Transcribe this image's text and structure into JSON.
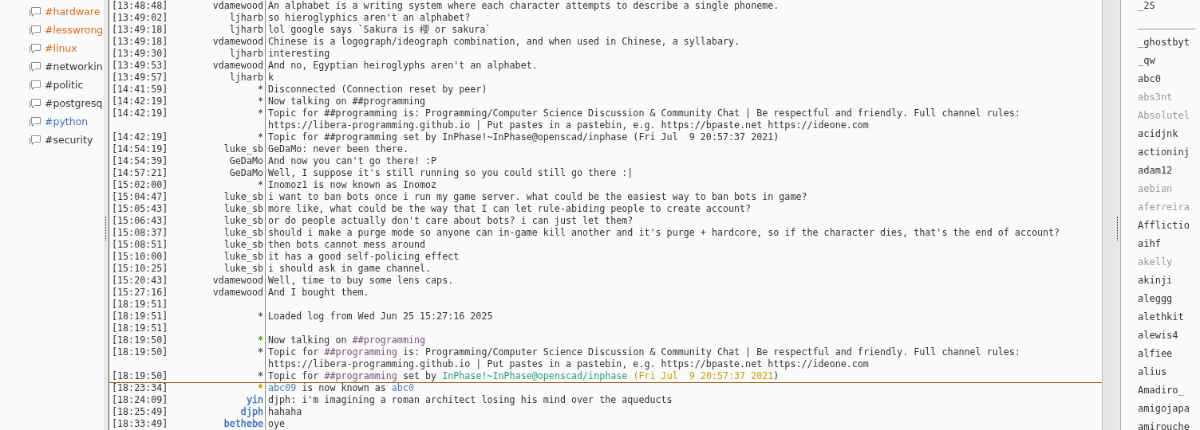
{
  "channels": [
    {
      "name": "#hardware",
      "color": "#d76b1c"
    },
    {
      "name": "#lesswrong",
      "color": "#d76b1c"
    },
    {
      "name": "#linux",
      "color": "#d76b1c"
    },
    {
      "name": "#networkin",
      "color": "#2e3436"
    },
    {
      "name": "#politic",
      "color": "#2e3436"
    },
    {
      "name": "#postgresq",
      "color": "#2e3436"
    },
    {
      "name": "#python",
      "color": "#3a6fbf"
    },
    {
      "name": "#security",
      "color": "#2e3436"
    }
  ],
  "chat": [
    {
      "time": "[13:48:48]",
      "nick": "vdamewood",
      "message": "An alphabet is a writing system where each character attempts to describe a single phoneme.",
      "marker_below": false
    },
    {
      "time": "[13:49:02]",
      "nick": "ljharb",
      "message": "so hieroglyphics aren't an alphabet?",
      "marker_below": false
    },
    {
      "time": "[13:49:18]",
      "nick": "ljharb",
      "message": "lol google says `Sakura is 櫻 or sakura`",
      "marker_below": false
    },
    {
      "time": "[13:49:18]",
      "nick": "vdamewood",
      "message": "Chinese is a logograph/ideograph combination, and when used in Chinese, a syllabary.",
      "marker_below": false
    },
    {
      "time": "[13:49:30]",
      "nick": "ljharb",
      "message": "interesting",
      "marker_below": false
    },
    {
      "time": "[13:49:53]",
      "nick": "vdamewood",
      "message": "And no, Egyptian heiroglyphs aren't an alphabet.",
      "marker_below": false
    },
    {
      "time": "[13:49:57]",
      "nick": "ljharb",
      "message": "k",
      "marker_below": false
    },
    {
      "time": "[14:41:59]",
      "nick": "*",
      "message": "Disconnected (Connection reset by peer)",
      "marker_below": false
    },
    {
      "time": "[14:42:19]",
      "nick": "*",
      "message": "Now talking on ##programming",
      "marker_below": false
    },
    {
      "time": "[14:42:19]",
      "nick": "*",
      "message": "Topic for ##programming is: Programming/Computer Science Discussion & Community Chat | Be respectful and friendly. Full channel rules: https://libera-programming.github.io | Put pastes in a pastebin, e.g. https://bpaste.net https://ideone.com",
      "marker_below": false
    },
    {
      "time": "[14:42:19]",
      "nick": "*",
      "message": "Topic for ##programming set by InPhase!~InPhase@openscad/inphase (Fri Jul  9 20:57:37 2021)",
      "marker_below": false
    },
    {
      "time": "[14:54:19]",
      "nick": "luke_sb",
      "message": "GeDaMo: never been there.",
      "marker_below": false
    },
    {
      "time": "[14:54:39]",
      "nick": "GeDaMo",
      "message": "And now you can't go there! :P",
      "marker_below": false
    },
    {
      "time": "[14:57:21]",
      "nick": "GeDaMo",
      "message": "Well, I suppose it's still running so you could still go there :|",
      "marker_below": false
    },
    {
      "time": "[15:02:00]",
      "nick": "*",
      "message": "Inomoz1 is now known as Inomoz",
      "marker_below": false
    },
    {
      "time": "[15:04:47]",
      "nick": "luke_sb",
      "message": "i want to ban bots once i run my game server. what could be the easiest way to ban bots in game?",
      "marker_below": false
    },
    {
      "time": "[15:05:43]",
      "nick": "luke_sb",
      "message": "more like, what could be the way that I can let rule-abiding people to create account?",
      "marker_below": false
    },
    {
      "time": "[15:06:43]",
      "nick": "luke_sb",
      "message": "or do people actually don't care about bots? i can just let them?",
      "marker_below": false
    },
    {
      "time": "[15:08:37]",
      "nick": "luke_sb",
      "message": "should i make a purge mode so anyone can in-game kill another and it's purge + hardcore, so if the character dies, that's the end of account?",
      "marker_below": false
    },
    {
      "time": "[15:08:51]",
      "nick": "luke_sb",
      "message": "then bots cannot mess around",
      "marker_below": false
    },
    {
      "time": "[15:10:00]",
      "nick": "luke_sb",
      "message": "it has a good self-policing effect",
      "marker_below": false
    },
    {
      "time": "[15:10:25]",
      "nick": "luke_sb",
      "message": "i should ask in game channel.",
      "marker_below": false
    },
    {
      "time": "[15:20:43]",
      "nick": "vdamewood",
      "message": "Well, time to buy some lens caps.",
      "marker_below": false
    },
    {
      "time": "[15:27:16]",
      "nick": "vdamewood",
      "message": "And I bought them.",
      "marker_below": false
    },
    {
      "time": "[18:19:51]",
      "marker_below": false
    },
    {
      "time": "[18:19:51]",
      "nick": "*",
      "message": "Loaded log from Wed Jun 25 15:27:16 2025",
      "marker_below": false
    },
    {
      "time": "[18:19:51]",
      "marker_below": false
    },
    {
      "time": "[18:19:50]",
      "nick": "*",
      "color": "#4e9a06",
      "parts": [
        {
          "text": "Now talking on ",
          "kind": "plain"
        },
        {
          "text": "##programming",
          "kind": "channel"
        }
      ],
      "marker_below": false
    },
    {
      "time": "[18:19:50]",
      "nick": "*",
      "color": "#75507b",
      "parts": [
        {
          "text": "Topic for ",
          "kind": "plain"
        },
        {
          "text": "##programming",
          "kind": "channel"
        },
        {
          "text": " is: Programming/Computer Science Discussion & Community Chat | Be respectful and friendly. Full channel rules: https://libera-programming.github.io | Put pastes in a pastebin, e.g. https://bpaste.net https://ideone.com",
          "kind": "plain"
        }
      ],
      "marker_below": false
    },
    {
      "time": "[18:19:50]",
      "nick": "*",
      "color": "#75507b",
      "parts": [
        {
          "text": "Topic for ",
          "kind": "plain"
        },
        {
          "text": "##programming",
          "kind": "channel"
        },
        {
          "text": " set by ",
          "kind": "plain"
        },
        {
          "text": "InPhase!~InPhase@openscad/inphase",
          "kind": "host"
        },
        {
          "text": " (Fri Jul  9 20:57:37 2021",
          "kind": "date"
        },
        {
          "text": ")",
          "kind": "plain"
        }
      ],
      "marker_below": true
    },
    {
      "time": "[18:23:34]",
      "nick": "*",
      "color": "#c4a000",
      "parts": [
        {
          "text": "abc09",
          "kind": "nick"
        },
        {
          "text": " is now known as ",
          "kind": "plain"
        },
        {
          "text": "abc0",
          "kind": "nick"
        }
      ],
      "marker_below": false
    },
    {
      "time": "[18:24:09]",
      "nick": "yin",
      "color": "#3a6fbf",
      "message": "djph: i'm imagining a roman architect losing his mind over the aqueducts",
      "marker_below": false
    },
    {
      "time": "[18:25:49]",
      "nick": "djph",
      "color": "#3a6fbf",
      "message": "hahaha",
      "marker_below": false
    },
    {
      "time": "[18:33:49]",
      "nick": "bethebe",
      "color": "#3a6fbf",
      "message": "oye",
      "marker_below": false
    }
  ],
  "users": [
    {
      "name": "_2S",
      "away": false
    },
    {
      "name": "__________",
      "away": false
    },
    {
      "name": "_ghostbyt",
      "away": false
    },
    {
      "name": "_qw",
      "away": false
    },
    {
      "name": "abc0",
      "away": false
    },
    {
      "name": "abs3nt",
      "away": true
    },
    {
      "name": "Absolutel",
      "away": true
    },
    {
      "name": "acidjnk",
      "away": false
    },
    {
      "name": "actioninj",
      "away": false
    },
    {
      "name": "adam12",
      "away": false
    },
    {
      "name": "aebian",
      "away": true
    },
    {
      "name": "aferreira",
      "away": true
    },
    {
      "name": "Afflictio",
      "away": false
    },
    {
      "name": "aihf",
      "away": false
    },
    {
      "name": "akelly",
      "away": true
    },
    {
      "name": "akinji",
      "away": false
    },
    {
      "name": "aleggg",
      "away": false
    },
    {
      "name": "alethkit",
      "away": false
    },
    {
      "name": "alewis4",
      "away": false
    },
    {
      "name": "alfiee",
      "away": false
    },
    {
      "name": "alius",
      "away": false
    },
    {
      "name": "Amadiro_",
      "away": false
    },
    {
      "name": "amigojapa",
      "away": false
    },
    {
      "name": "amirouche",
      "away": false
    }
  ]
}
